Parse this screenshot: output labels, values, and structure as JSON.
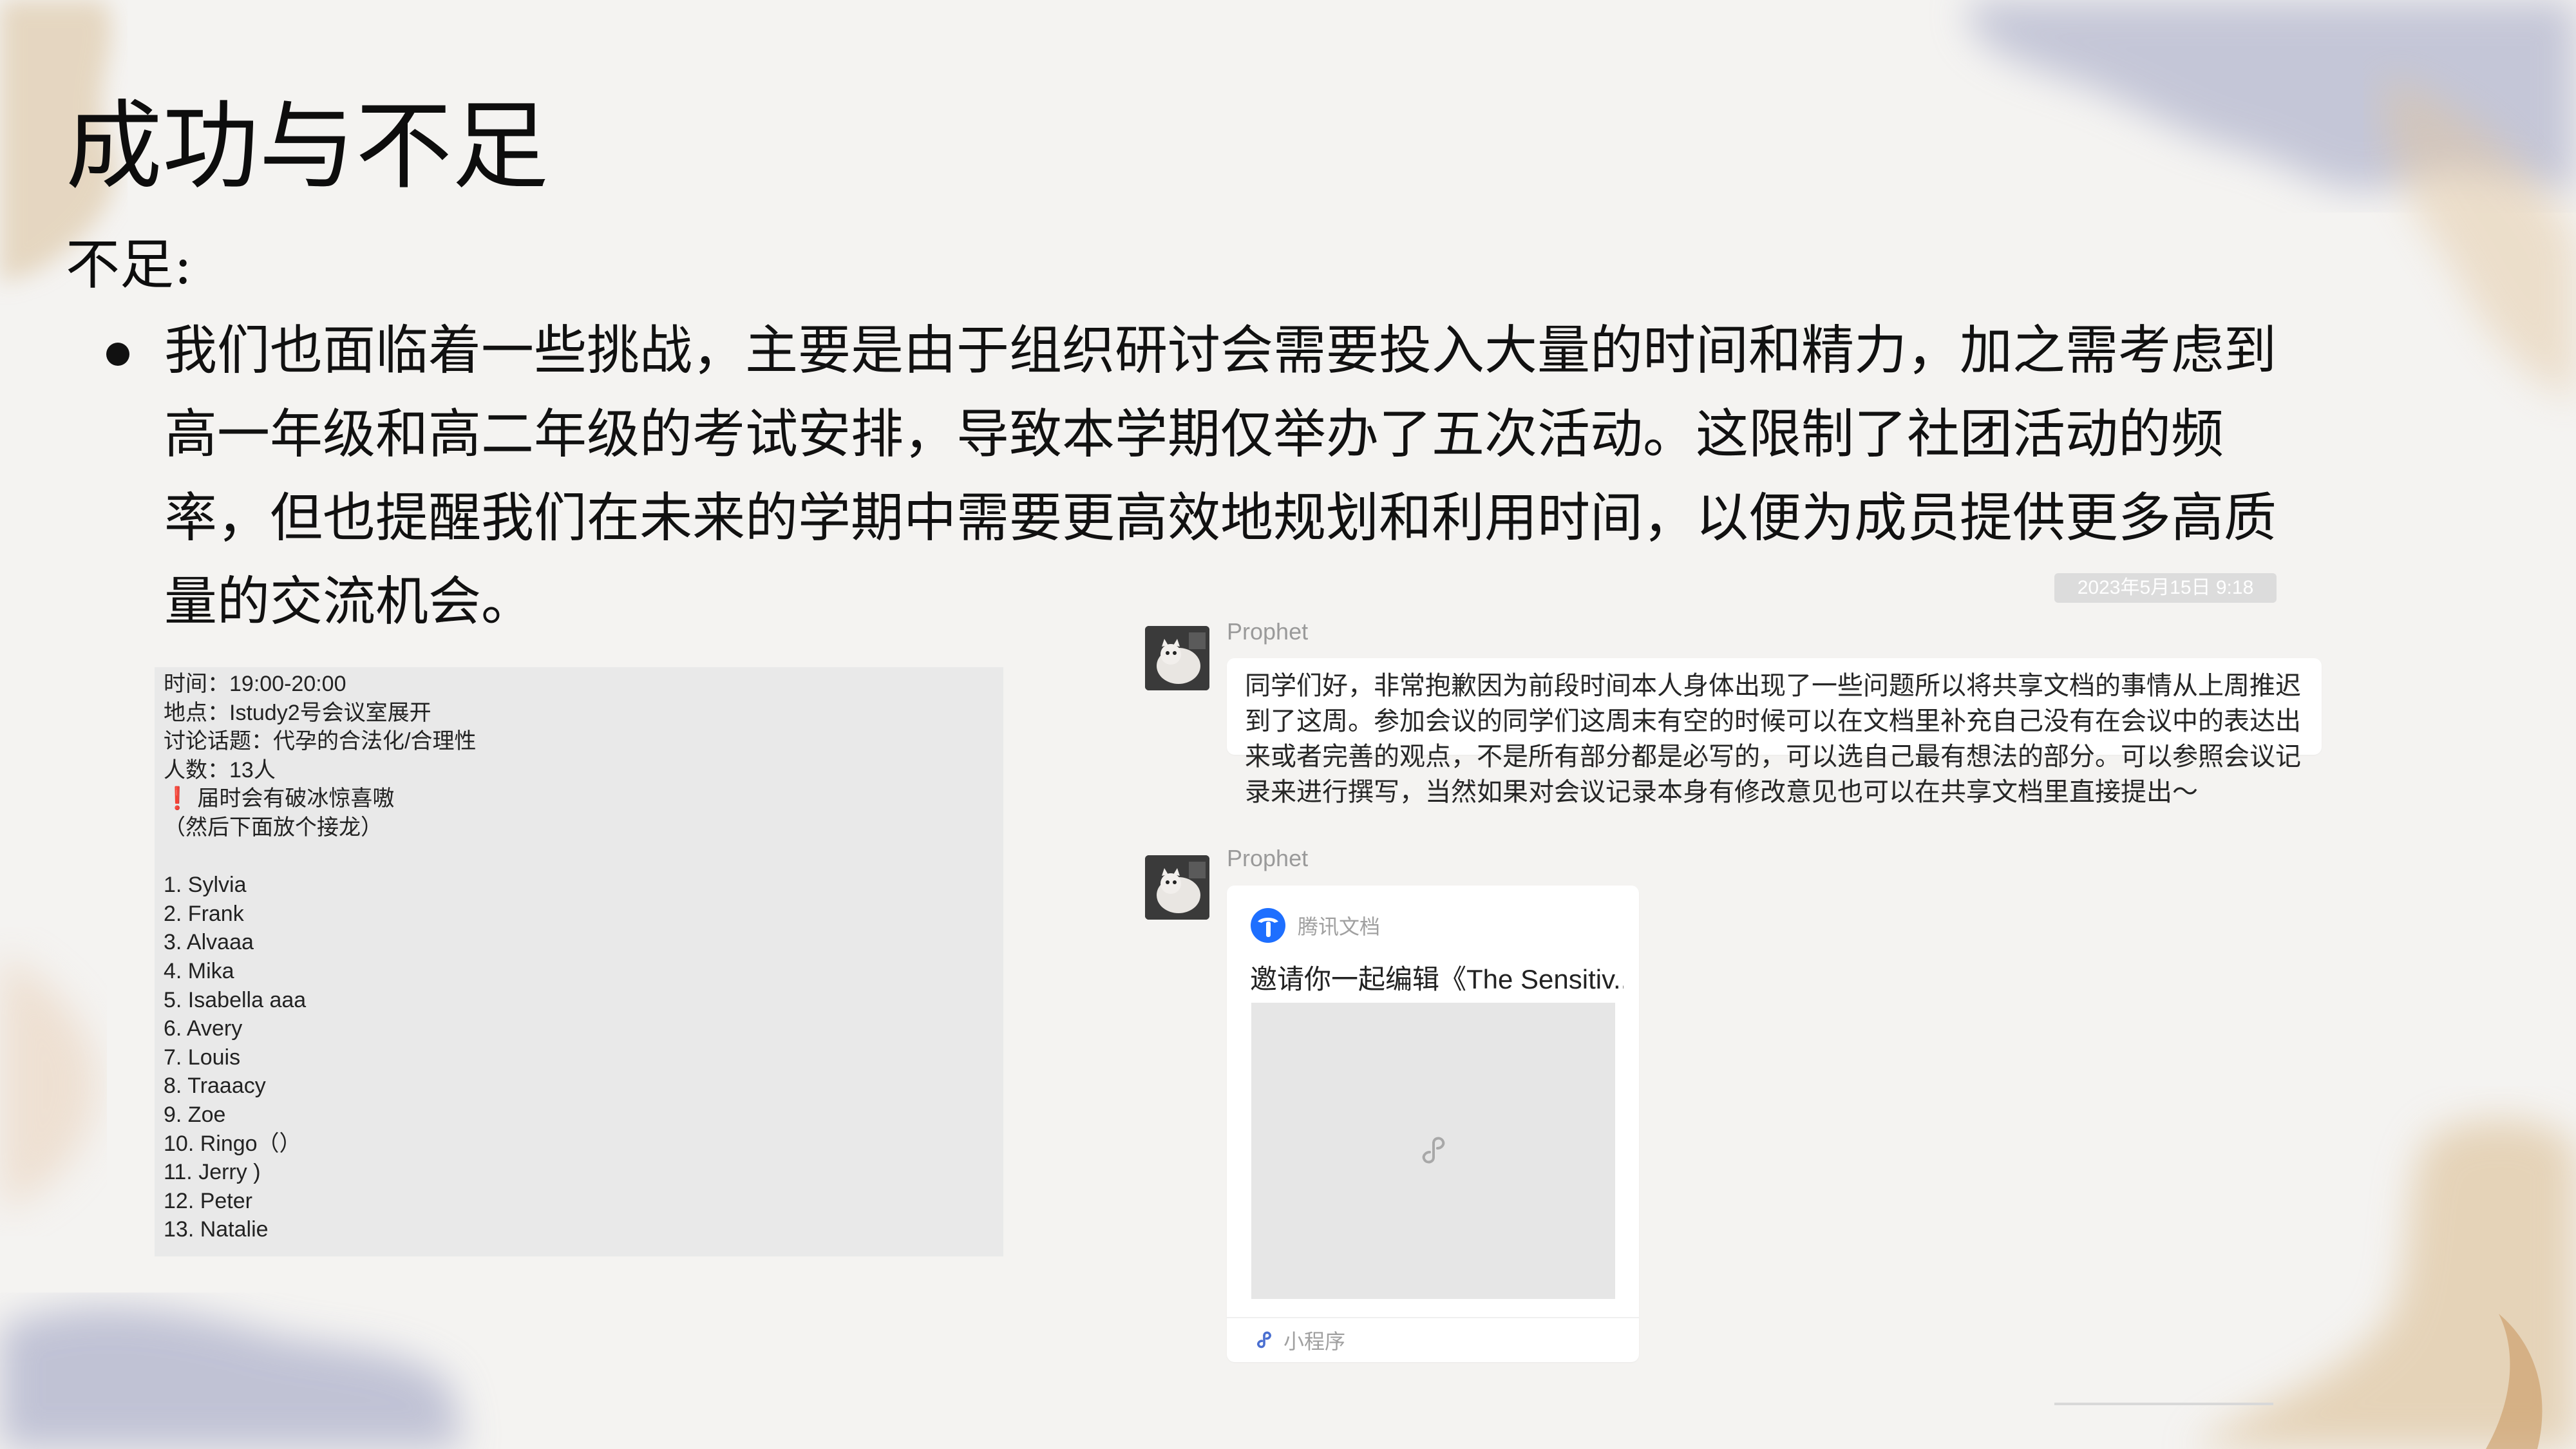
{
  "slide": {
    "title": "成功与不足",
    "subheading": "不足:",
    "bullet": "我们也面临着一些挑战，主要是由于组织研讨会需要投入大量的时间和精力，加之需考虑到高一年级和高二年级的考试安排，导致本学期仅举办了五次活动。这限制了社团活动的频率，但也提醒我们在未来的学期中需要更高效地规划和利用时间，以便为成员提供更多高质量的交流机会。"
  },
  "notice": {
    "lines": [
      "时间：19:00-20:00",
      "地点：Istudy2号会议室展开",
      "讨论话题：代孕的合法化/合理性",
      "人数：13人"
    ],
    "warning_icon": "❗",
    "warning": "届时会有破冰惊喜嗷",
    "followup": "（然后下面放个接龙）",
    "attendees": [
      "1. Sylvia",
      "2. Frank",
      "3. Alvaaa",
      "4. Mika",
      "5. Isabella aaa",
      "6. Avery",
      "7. Louis",
      "8. Traaacy",
      "9. Zoe",
      "10. Ringo（）",
      "11. Jerry )",
      "12. Peter",
      "13. Natalie"
    ]
  },
  "chat": {
    "timestamp": "2023年5月15日 9:18",
    "messages": [
      {
        "sender": "Prophet",
        "text": "同学们好，非常抱歉因为前段时间本人身体出现了一些问题所以将共享文档的事情从上周推迟到了这周。参加会议的同学们这周末有空的时候可以在文档里补充自己没有在会议中的表达出来或者完善的观点，不是所有部分都是必写的，可以选自己最有想法的部分。可以参照会议记录来进行撰写，当然如果对会议记录本身有修改意见也可以在共享文档里直接提出～"
      },
      {
        "sender": "Prophet",
        "card": {
          "brand": "腾讯文档",
          "title": "邀请你一起编辑《The Sensitiv...",
          "footer": "小程序"
        }
      }
    ]
  },
  "colors": {
    "background": "#f4f3f1",
    "notice_bg": "#e9e9e9",
    "warning": "#d21f1f",
    "tencent_blue": "#1e6fff"
  }
}
